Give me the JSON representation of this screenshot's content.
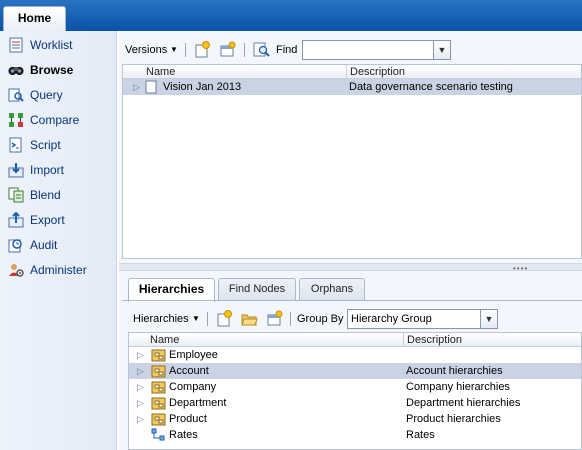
{
  "header": {
    "home_tab": "Home"
  },
  "sidebar": {
    "items": [
      {
        "label": "Worklist",
        "icon": "worklist-icon"
      },
      {
        "label": "Browse",
        "icon": "browse-icon"
      },
      {
        "label": "Query",
        "icon": "query-icon"
      },
      {
        "label": "Compare",
        "icon": "compare-icon"
      },
      {
        "label": "Script",
        "icon": "script-icon"
      },
      {
        "label": "Import",
        "icon": "import-icon"
      },
      {
        "label": "Blend",
        "icon": "blend-icon"
      },
      {
        "label": "Export",
        "icon": "export-icon"
      },
      {
        "label": "Audit",
        "icon": "audit-icon"
      },
      {
        "label": "Administer",
        "icon": "administer-icon"
      }
    ]
  },
  "versions": {
    "menu_label": "Versions",
    "find_label": "Find",
    "find_value": "",
    "columns": [
      "Name",
      "Description"
    ],
    "rows": [
      {
        "name": "Vision Jan 2013",
        "description": "Data governance scenario testing"
      }
    ]
  },
  "tabs": [
    "Hierarchies",
    "Find Nodes",
    "Orphans"
  ],
  "hierarchies": {
    "menu_label": "Hierarchies",
    "group_by_label": "Group By",
    "group_by_value": "Hierarchy Group",
    "columns": [
      "Name",
      "Description"
    ],
    "rows": [
      {
        "name": "Employee",
        "description": ""
      },
      {
        "name": "Account",
        "description": "Account hierarchies"
      },
      {
        "name": "Company",
        "description": "Company hierarchies"
      },
      {
        "name": "Department",
        "description": "Department hierarchies"
      },
      {
        "name": "Product",
        "description": "Product hierarchies"
      },
      {
        "name": "Rates",
        "description": "Rates"
      }
    ]
  },
  "colors": {
    "header": "#0a52a8",
    "selection": "#c9d3e4",
    "nav_text": "#08347a"
  }
}
